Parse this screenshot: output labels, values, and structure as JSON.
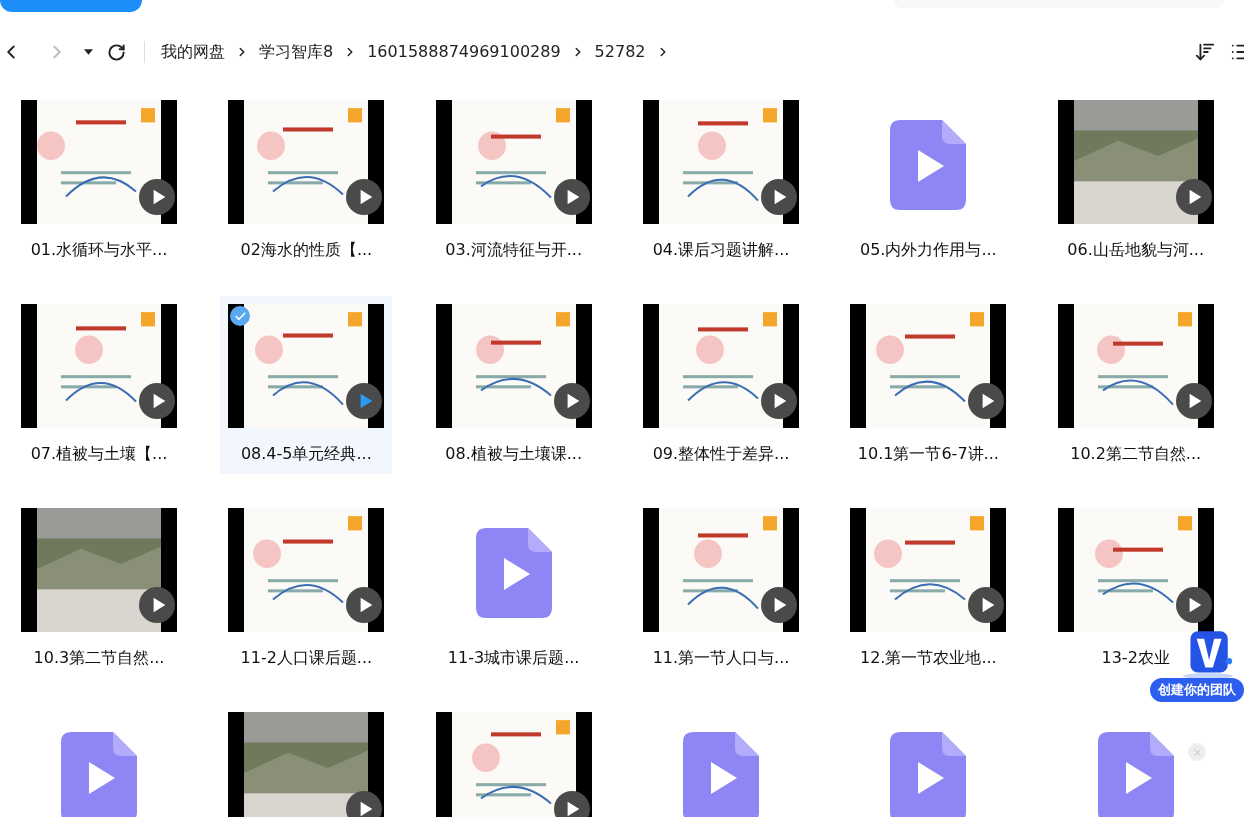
{
  "breadcrumb": [
    "我的网盘",
    "学习智库8",
    "1601588874969100289",
    "52782"
  ],
  "files": [
    {
      "kind": "thumbnail",
      "name": "01.水循环与水平...",
      "selected": false
    },
    {
      "kind": "thumbnail",
      "name": "02海水的性质【...",
      "selected": false
    },
    {
      "kind": "thumbnail",
      "name": "03.河流特征与开...",
      "selected": false
    },
    {
      "kind": "thumbnail",
      "name": "04.课后习题讲解...",
      "selected": false
    },
    {
      "kind": "file-icon",
      "name": "05.内外力作用与...",
      "selected": false
    },
    {
      "kind": "thumbnail",
      "name": "06.山岳地貌与河...",
      "selected": false
    },
    {
      "kind": "thumbnail",
      "name": "07.植被与土壤【...",
      "selected": false
    },
    {
      "kind": "thumbnail",
      "name": "08.4-5单元经典...",
      "selected": true
    },
    {
      "kind": "thumbnail",
      "name": "08.植被与土壤课...",
      "selected": false
    },
    {
      "kind": "thumbnail",
      "name": "09.整体性于差异...",
      "selected": false
    },
    {
      "kind": "thumbnail",
      "name": "10.1第一节6-7讲...",
      "selected": false
    },
    {
      "kind": "thumbnail",
      "name": "10.2第二节自然...",
      "selected": false
    },
    {
      "kind": "thumbnail",
      "name": "10.3第二节自然...",
      "selected": false
    },
    {
      "kind": "thumbnail",
      "name": "11-2人口课后题...",
      "selected": false
    },
    {
      "kind": "file-icon",
      "name": "11-3城市课后题...",
      "selected": false
    },
    {
      "kind": "thumbnail",
      "name": "11.第一节人口与...",
      "selected": false
    },
    {
      "kind": "thumbnail",
      "name": "12.第一节农业地...",
      "selected": false
    },
    {
      "kind": "thumbnail",
      "name": "13-2农业",
      "selected": false
    },
    {
      "kind": "file-icon",
      "selected": false
    },
    {
      "kind": "thumbnail",
      "selected": false
    },
    {
      "kind": "thumbnail",
      "selected": false
    },
    {
      "kind": "file-icon",
      "selected": false
    },
    {
      "kind": "file-icon",
      "selected": false
    },
    {
      "kind": "file-icon",
      "selected": false
    }
  ],
  "team_badge": {
    "label": "创建你的团队"
  }
}
